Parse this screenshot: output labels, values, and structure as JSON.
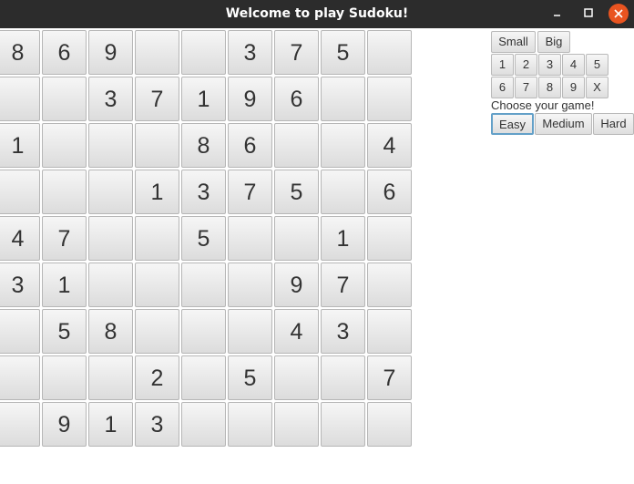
{
  "window": {
    "title": "Welcome to play Sudoku!",
    "close_color": "#e95420"
  },
  "grid": {
    "rows": [
      [
        "8",
        "6",
        "9",
        "",
        "",
        "3",
        "7",
        "5",
        ""
      ],
      [
        "",
        "",
        "3",
        "7",
        "1",
        "9",
        "6",
        "",
        ""
      ],
      [
        "1",
        "",
        "",
        "",
        "8",
        "6",
        "",
        "",
        "4"
      ],
      [
        "",
        "",
        "",
        "1",
        "3",
        "7",
        "5",
        "",
        "6"
      ],
      [
        "4",
        "7",
        "",
        "",
        "5",
        "",
        "",
        "1",
        ""
      ],
      [
        "3",
        "1",
        "",
        "",
        "",
        "",
        "9",
        "7",
        ""
      ],
      [
        "",
        "5",
        "8",
        "",
        "",
        "",
        "4",
        "3",
        ""
      ],
      [
        "",
        "",
        "",
        "2",
        "",
        "5",
        "",
        "",
        "7"
      ],
      [
        "",
        "9",
        "1",
        "3",
        "",
        "",
        "",
        "",
        ""
      ]
    ]
  },
  "size_buttons": [
    "Small",
    "Big"
  ],
  "number_buttons": [
    [
      "1",
      "2",
      "3",
      "4",
      "5"
    ],
    [
      "6",
      "7",
      "8",
      "9",
      "X"
    ]
  ],
  "choose_label": "Choose your game!",
  "difficulty_buttons": [
    "Easy",
    "Medium",
    "Hard"
  ],
  "selected_difficulty": "Easy"
}
